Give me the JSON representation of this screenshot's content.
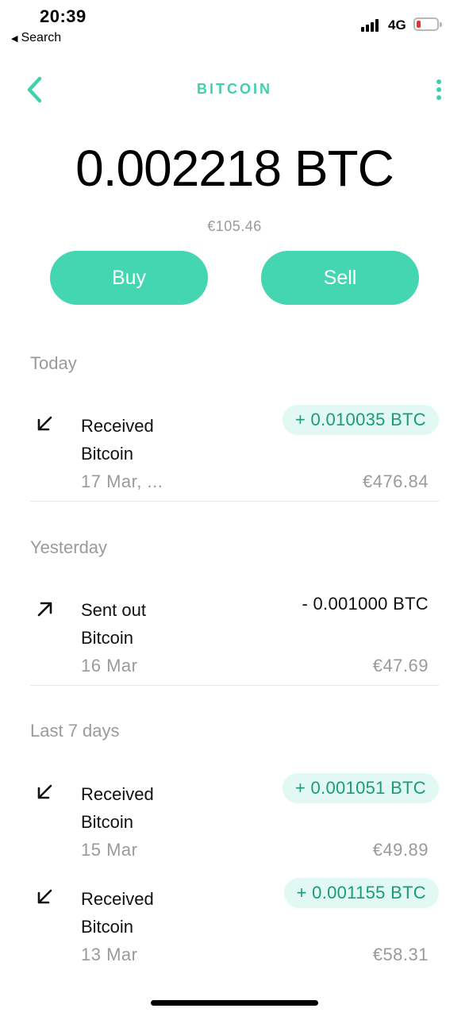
{
  "status_bar": {
    "time": "20:39",
    "back_label": "Search",
    "network": "4G"
  },
  "header": {
    "title": "BITCOIN"
  },
  "balance": {
    "crypto": "0.002218 BTC",
    "fiat": "€105.46"
  },
  "actions": {
    "buy_label": "Buy",
    "sell_label": "Sell"
  },
  "colors": {
    "accent": "#44d5b1",
    "accent_text": "#3fd1ad",
    "incoming_bg": "#e2f8f2",
    "incoming_text": "#1a9b7a",
    "battery_low": "#e8342d"
  },
  "sections": [
    {
      "label": "Today",
      "transactions": [
        {
          "icon": "arrow-down-left-icon",
          "line1": "Received",
          "line2": "Bitcoin",
          "date": "17 Mar, ...",
          "amount": "+ 0.010035 BTC",
          "fiat": "€476.84",
          "direction": "in"
        }
      ]
    },
    {
      "label": "Yesterday",
      "transactions": [
        {
          "icon": "arrow-up-right-icon",
          "line1": "Sent out",
          "line2": "Bitcoin",
          "date": "16 Mar",
          "amount": "- 0.001000 BTC",
          "fiat": "€47.69",
          "direction": "out"
        }
      ]
    },
    {
      "label": "Last 7 days",
      "transactions": [
        {
          "icon": "arrow-down-left-icon",
          "line1": "Received",
          "line2": "Bitcoin",
          "date": "15 Mar",
          "amount": "+ 0.001051 BTC",
          "fiat": "€49.89",
          "direction": "in"
        },
        {
          "icon": "arrow-down-left-icon",
          "line1": "Received",
          "line2": "Bitcoin",
          "date": "13 Mar",
          "amount": "+ 0.001155 BTC",
          "fiat": "€58.31",
          "direction": "in"
        }
      ]
    }
  ]
}
